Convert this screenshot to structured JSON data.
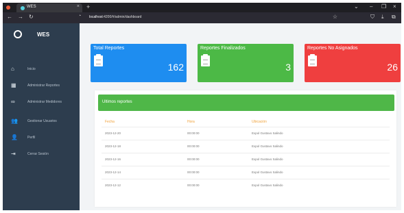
{
  "browser": {
    "tab_title": "WES",
    "tab_close": "×",
    "new_tab": "+",
    "url_host": "localhost",
    "url_path": ":4200/#/admin/dashboard",
    "window_controls": [
      "⌄",
      "–",
      "❐",
      "×"
    ]
  },
  "sidebar": {
    "brand": "WES",
    "items": [
      {
        "label": "Inicio",
        "icon": "home-icon",
        "glyph": "⌂"
      },
      {
        "label": "Administrar Reportes",
        "icon": "clipboard-icon",
        "glyph": "▦"
      },
      {
        "label": "Administrar Medidores",
        "icon": "link-icon",
        "glyph": "∞"
      },
      {
        "label": "Gestionar Usuarios",
        "icon": "users-icon",
        "glyph": "👥"
      },
      {
        "label": "Perfil",
        "icon": "user-icon",
        "glyph": "👤"
      },
      {
        "label": "Cerrar Sesión",
        "icon": "logout-icon",
        "glyph": "⇥"
      }
    ]
  },
  "cards": [
    {
      "title": "Total Reportes",
      "value": "162",
      "color": "#1e8df0"
    },
    {
      "title": "Reportes Finalizados",
      "value": "3",
      "color": "#4cb946"
    },
    {
      "title": "Reportes No Asignados",
      "value": "26",
      "color": "#ef3f3f"
    }
  ],
  "panel": {
    "title": "Ultimos reportes",
    "headers": [
      "Fecha",
      "Hora",
      "Ubicación"
    ],
    "rows": [
      [
        "2023-12-20",
        "00:00:00",
        "Expol Gustavo Salindo"
      ],
      [
        "2023-12-18",
        "00:00:00",
        "Expol Gustavo Salindo"
      ],
      [
        "2023-12-16",
        "00:00:00",
        "Expol Gustavo Salindo"
      ],
      [
        "2023-12-14",
        "00:00:00",
        "Expol Gustavo Salindo"
      ],
      [
        "2023-12-12",
        "00:00:00",
        "Expol Gustavo Salindo"
      ]
    ]
  },
  "colors": {
    "sidebar": "#2d3d4e",
    "header_green": "#4fb748",
    "table_header": "#f0a23a"
  }
}
